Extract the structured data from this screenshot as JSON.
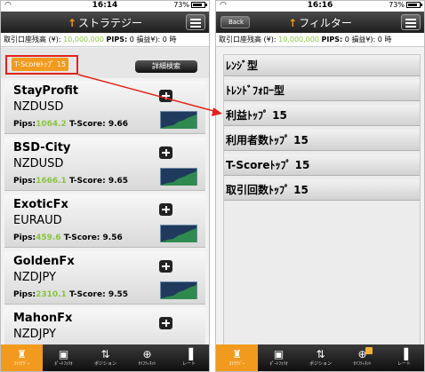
{
  "status": {
    "time": "16:14",
    "battery": "73%",
    "time_right": "16:16",
    "battery_right": "73%",
    "battery_level": 0.73
  },
  "left": {
    "back_label": "",
    "title": "ストラテジー",
    "info": {
      "balance_label": "取引口座残高 (¥):",
      "balance_value": "10,000,000",
      "pips_label": "PIPS:",
      "pips_value": "0",
      "pl_label": "損益¥):",
      "pl_value": "0",
      "extra": "時"
    },
    "sort_label": "T-Scoreﾄｯﾌﾟ 15",
    "detail_label": "詳細検索",
    "strategies": [
      {
        "name": "StayProfit",
        "pair": "NZDUSD",
        "pips_label": "Pips:",
        "pips": "1064.2",
        "tscore_label": "T-Score:",
        "tscore": "9.66"
      },
      {
        "name": "BSD-City",
        "pair": "NZDUSD",
        "pips_label": "Pips:",
        "pips": "1666.1",
        "tscore_label": "T-Score:",
        "tscore": "9.65"
      },
      {
        "name": "ExoticFx",
        "pair": "EURAUD",
        "pips_label": "Pips:",
        "pips": "459.6",
        "tscore_label": "T-Score:",
        "tscore": "9.56"
      },
      {
        "name": "GoldenFx",
        "pair": "NZDJPY",
        "pips_label": "Pips:",
        "pips": "2310.1",
        "tscore_label": "T-Score:",
        "tscore": "9.55"
      },
      {
        "name": "MahonFx",
        "pair": "NZDJPY",
        "pips_label": "",
        "pips": "",
        "tscore_label": "",
        "tscore": ""
      }
    ]
  },
  "right": {
    "back_label": "Back",
    "title": "フィルター",
    "info": {
      "balance_label": "取引口座残高 (¥):",
      "balance_value": "10,000,000",
      "pips_label": "PIPS:",
      "pips_value": "0",
      "pl_label": "損益¥):",
      "pl_value": "0",
      "extra": "時"
    },
    "filters": [
      "ﾚﾝｼﾞ型",
      "ﾄﾚﾝﾄﾞﾌｫﾛｰ型",
      "利益ﾄｯﾌﾟ 15",
      "利用者数ﾄｯﾌﾟ 15",
      "T-Scoreﾄｯﾌﾟ 15",
      "取引回数ﾄｯﾌﾟ 15"
    ]
  },
  "tabs": [
    {
      "label": "ｽﾄﾗﾃｼﾞｰ",
      "icon": "chess-rook-icon"
    },
    {
      "label": "ﾎﾟｰﾄﾌｫﾘｵ",
      "icon": "briefcase-icon"
    },
    {
      "label": "ポジション",
      "icon": "updown-arrows-icon"
    },
    {
      "label": "ｾｲﾌﾃｨﾈｯﾄ",
      "icon": "target-icon"
    },
    {
      "label": "レート",
      "icon": "bar-chart-icon"
    }
  ],
  "colors": {
    "accent": "#f29a1e",
    "pips_green": "#8ac43f",
    "highlight_red": "#e3231e"
  }
}
